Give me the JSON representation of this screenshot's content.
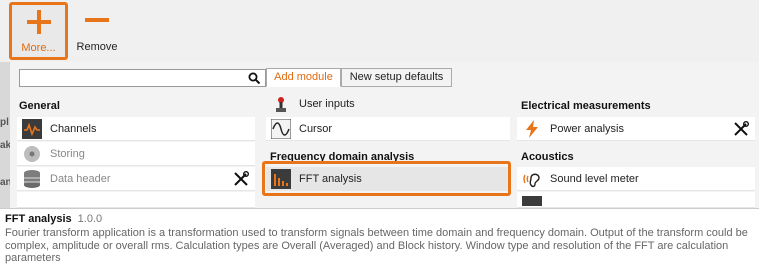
{
  "toolbar": {
    "more_label": "More...",
    "remove_label": "Remove",
    "accent": "#e8751a"
  },
  "side_fragments": [
    "pl",
    "ak",
    "an"
  ],
  "search": {
    "placeholder": "",
    "value": ""
  },
  "tabs": [
    {
      "label": "Add module",
      "selected": true
    },
    {
      "label": "New setup defaults",
      "selected": false
    }
  ],
  "columns": {
    "general": {
      "title": "General",
      "items": [
        {
          "label": "Channels",
          "icon": "channels-icon",
          "enabled": true
        },
        {
          "label": "Storing",
          "icon": "storing-icon",
          "enabled": false
        },
        {
          "label": "Data header",
          "icon": "data-header-icon",
          "enabled": false,
          "tool": true
        }
      ]
    },
    "middle": {
      "items_top": [
        {
          "label": "User inputs",
          "icon": "user-inputs-icon"
        },
        {
          "label": "Cursor",
          "icon": "cursor-icon"
        }
      ],
      "freq_title": "Frequency domain analysis",
      "freq_items": [
        {
          "label": "FFT analysis",
          "icon": "fft-icon",
          "selected": true
        }
      ]
    },
    "electrical": {
      "title": "Electrical measurements",
      "items": [
        {
          "label": "Power analysis",
          "icon": "power-icon",
          "tool": true
        }
      ]
    },
    "acoustics": {
      "title": "Acoustics",
      "items": [
        {
          "label": "Sound level meter",
          "icon": "sound-level-icon"
        }
      ]
    }
  },
  "description": {
    "title": "FFT analysis",
    "version": "1.0.0",
    "text": "Fourier transform application is a transformation used to transform signals between time domain and frequency domain. Output of the transform could be complex, amplitude or overall rms. Calculation types are Overall (Averaged) and Block history. Window type and resolution of the FFT are calculation parameters"
  }
}
